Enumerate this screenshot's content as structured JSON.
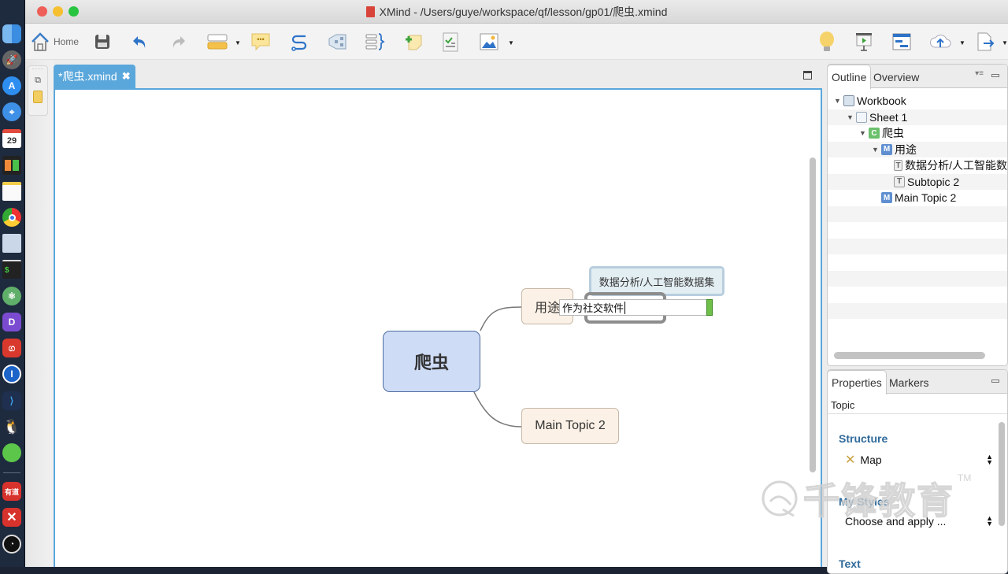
{
  "window": {
    "title": "XMind - /Users/guye/workspace/qf/lesson/gp01/爬虫.xmind"
  },
  "dock": {
    "apps": [
      "finder-icon",
      "launchpad-icon",
      "app-store-icon",
      "safari-icon",
      "calendar-icon",
      "mission-control-icon",
      "notes-icon",
      "chrome-icon",
      "preview-icon",
      "terminal-icon",
      "atom-icon",
      "dash-icon",
      "netease-music-icon",
      "1password-icon",
      "vscode-icon",
      "qq-icon",
      "wechat-icon",
      "youdao-icon",
      "xmind-icon",
      "obs-icon"
    ],
    "calendar_day": "29",
    "youdao_label": "有道",
    "terminal_label": "$"
  },
  "toolbar": {
    "home_label": "Home",
    "buttons": [
      "home",
      "save",
      "undo",
      "redo",
      "topic",
      "callout",
      "relationship",
      "boundary",
      "summary",
      "note",
      "task",
      "image",
      "idea",
      "presentation",
      "gantt",
      "share",
      "export"
    ]
  },
  "editor": {
    "tab_label": "*爬虫.xmind",
    "tab_close": "✖"
  },
  "mindmap": {
    "central_topic": "爬虫",
    "main_topics": [
      {
        "label": "用途",
        "subtopics": [
          "数据分析/人工智能数据集",
          "Subtopic 2"
        ]
      },
      {
        "label": "Main Topic 2"
      }
    ],
    "editing_text": "作为社交软件"
  },
  "outline": {
    "tabs": [
      "Outline",
      "Overview"
    ],
    "active_tab": "Outline",
    "tree": [
      {
        "label": "Workbook",
        "icon": "W",
        "level": 0
      },
      {
        "label": "Sheet 1",
        "icon": "S",
        "level": 1
      },
      {
        "label": "爬虫",
        "icon": "C",
        "level": 2
      },
      {
        "label": "用途",
        "icon": "M",
        "level": 3
      },
      {
        "label": "数据分析/人工智能数",
        "icon": "T",
        "level": 4
      },
      {
        "label": "Subtopic 2",
        "icon": "T",
        "level": 4
      },
      {
        "label": "Main Topic 2",
        "icon": "M",
        "level": 3
      }
    ]
  },
  "properties": {
    "tabs": [
      "Properties",
      "Markers"
    ],
    "active_tab": "Properties",
    "context": "Topic",
    "structure_heading": "Structure",
    "structure_value": "Map",
    "styles_heading": "My Styles",
    "styles_value": "Choose and apply ...",
    "text_heading": "Text"
  },
  "watermark": {
    "text": "千锋教育",
    "tm": "TM"
  },
  "colors": {
    "accent": "#5aa7dc",
    "central_fill": "#cfdcf6",
    "main_fill": "#fbf1e6",
    "sub_fill": "#e3eef3",
    "heading_blue": "#2f6a9a"
  }
}
